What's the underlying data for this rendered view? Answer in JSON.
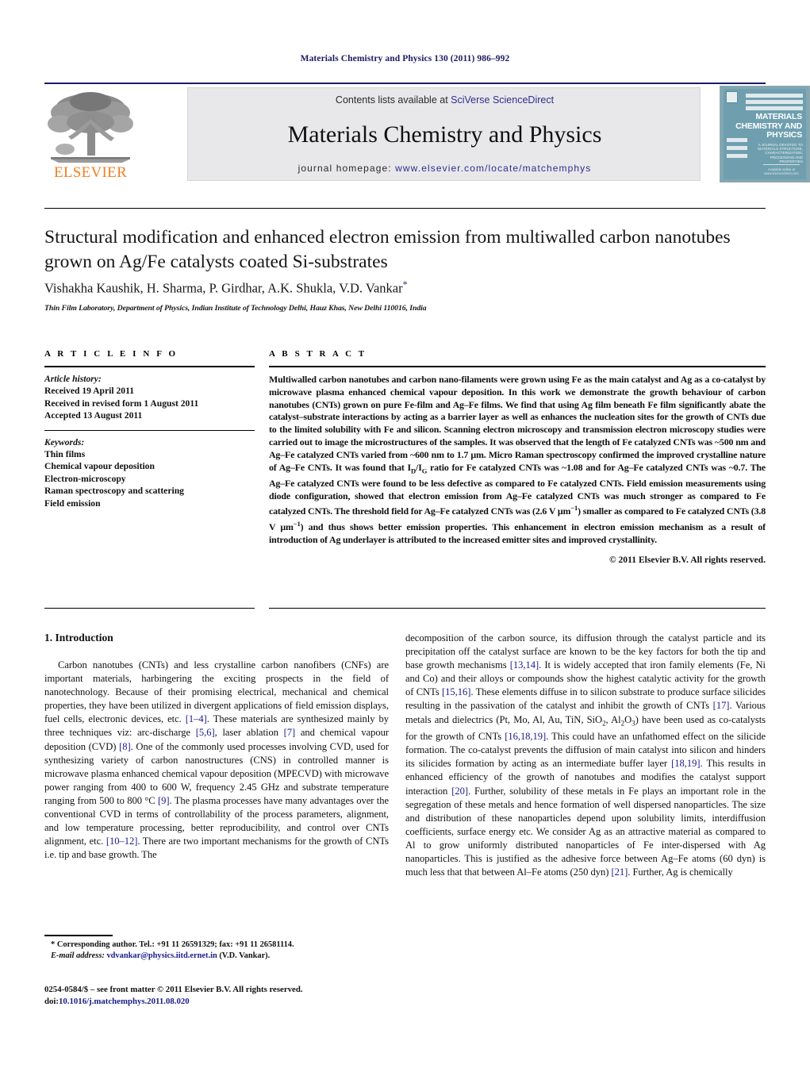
{
  "running_head": "Materials Chemistry and Physics 130 (2011) 986–992",
  "masthead": {
    "contents_prefix": "Contents lists available at ",
    "contents_link": "SciVerse ScienceDirect",
    "journal_title": "Materials Chemistry and Physics",
    "homepage_prefix": "journal homepage: ",
    "homepage_url": "www.elsevier.com/locate/matchemphys",
    "publisher_wordmark": "ELSEVIER",
    "cover": {
      "title_lines": [
        "MATERIALS",
        "CHEMISTRY AND",
        "PHYSICS"
      ],
      "subtitle": "A JOURNAL DEVOTED TO MATERIALS STRUCTURE, CHARACTERIZATION, PROCESSING AND PROPERTIES",
      "footer": "Available online at www.sciencedirect.com"
    },
    "colors": {
      "link": "#2d2d8f",
      "band": "#e8e8ea",
      "elsevier_orange": "#f08023",
      "cover_teal": "#6f9faf",
      "running_head": "#1b1b63"
    }
  },
  "article": {
    "title": "Structural modification and enhanced electron emission from multiwalled carbon nanotubes grown on Ag/Fe catalysts coated Si-substrates",
    "authors": "Vishakha Kaushik, H. Sharma, P. Girdhar, A.K. Shukla, V.D. Vankar",
    "author_marker": "*",
    "affiliation": "Thin Film Laboratory, Department of Physics, Indian Institute of Technology Delhi, Hauz Khas, New Delhi 110016, India"
  },
  "article_info": {
    "heading": "A R T I C L E  I N F O",
    "history_label": "Article history:",
    "history": [
      "Received 19 April 2011",
      "Received in revised form 1 August 2011",
      "Accepted 13 August 2011"
    ],
    "keywords_label": "Keywords:",
    "keywords": [
      "Thin films",
      "Chemical vapour deposition",
      "Electron-microscopy",
      "Raman spectroscopy and scattering",
      "Field emission"
    ]
  },
  "abstract": {
    "heading": "A B S T R A C T",
    "text": "Multiwalled carbon nanotubes and carbon nano-filaments were grown using Fe as the main catalyst and Ag as a co-catalyst by microwave plasma enhanced chemical vapour deposition. In this work we demonstrate the growth behaviour of carbon nanotubes (CNTs) grown on pure Fe-film and Ag–Fe films. We find that using Ag film beneath Fe film significantly abate the catalyst–substrate interactions by acting as a barrier layer as well as enhances the nucleation sites for the growth of CNTs due to the limited solubility with Fe and silicon. Scanning electron microscopy and transmission electron microscopy studies were carried out to image the microstructures of the samples. It was observed that the length of Fe catalyzed CNTs was ~500 nm and Ag–Fe catalyzed CNTs varied from ~600 nm to 1.7 μm. Micro Raman spectroscopy confirmed the improved crystalline nature of Ag–Fe CNTs. It was found that ID/IG ratio for Fe catalyzed CNTs was ~1.08 and for Ag–Fe catalyzed CNTs was ~0.7. The Ag–Fe catalyzed CNTs were found to be less defective as compared to Fe catalyzed CNTs. Field emission measurements using diode configuration, showed that electron emission from Ag–Fe catalyzed CNTs was much stronger as compared to Fe catalyzed CNTs. The threshold field for Ag–Fe catalyzed CNTs was (2.6 V μm−1) smaller as compared to Fe catalyzed CNTs (3.8 V μm−1) and thus shows better emission properties. This enhancement in electron emission mechanism as a result of introduction of Ag underlayer is attributed to the increased emitter sites and improved crystallinity.",
    "copyright": "© 2011 Elsevier B.V. All rights reserved."
  },
  "body": {
    "section_heading": "1.  Introduction",
    "left_paragraph": "Carbon nanotubes (CNTs) and less crystalline carbon nanofibers (CNFs) are important materials, harbingering the exciting prospects in the field of nanotechnology. Because of their promising electrical, mechanical and chemical properties, they have been utilized in divergent applications of field emission displays, fuel cells, electronic devices, etc. [1–4]. These materials are synthesized mainly by three techniques viz: arc-discharge [5,6], laser ablation [7] and chemical vapour deposition (CVD) [8]. One of the commonly used processes involving CVD, used for synthesizing variety of carbon nanostructures (CNS) in controlled manner is microwave plasma enhanced chemical vapour deposition (MPECVD) with microwave power ranging from 400 to 600 W, frequency 2.45 GHz and substrate temperature ranging from 500 to 800 °C [9]. The plasma processes have many advantages over the conventional CVD in terms of controllability of the process parameters, alignment, and low temperature processing, better reproducibility, and control over CNTs alignment, etc. [10–12]. There are two important mechanisms for the growth of CNTs i.e. tip and base growth. The",
    "right_paragraph": "decomposition of the carbon source, its diffusion through the catalyst particle and its precipitation off the catalyst surface are known to be the key factors for both the tip and base growth mechanisms [13,14]. It is widely accepted that iron family elements (Fe, Ni and Co) and their alloys or compounds show the highest catalytic activity for the growth of CNTs [15,16]. These elements diffuse in to silicon substrate to produce surface silicides resulting in the passivation of the catalyst and inhibit the growth of CNTs [17]. Various metals and dielectrics (Pt, Mo, Al, Au, TiN, SiO2, Al2O3) have been used as co-catalysts for the growth of CNTs [16,18,19]. This could have an unfathomed effect on the silicide formation. The co-catalyst prevents the diffusion of main catalyst into silicon and hinders its silicides formation by acting as an intermediate buffer layer [18,19]. This results in enhanced efficiency of the growth of nanotubes and modifies the catalyst support interaction [20]. Further, solubility of these metals in Fe plays an important role in the segregation of these metals and hence formation of well dispersed nanoparticles. The size and distribution of these nanoparticles depend upon solubility limits, interdiffusion coefficients, surface energy etc. We consider Ag as an attractive material as compared to Al to grow uniformly distributed nanoparticles of Fe inter-dispersed with Ag nanoparticles. This is justified as the adhesive force between Ag–Fe atoms (60 dyn) is much less that that between Al–Fe atoms (250 dyn) [21]. Further, Ag is chemically"
  },
  "footer": {
    "corresponding_marker": "*",
    "corresponding_text": "Corresponding author. Tel.: +91 11 26591329; fax: +91 11 26581114.",
    "email_label": "E-mail address:",
    "email": "vdvankar@physics.iitd.ernet.in",
    "email_owner": "(V.D. Vankar).",
    "imprint_line": "0254-0584/$ – see front matter © 2011 Elsevier B.V. All rights reserved.",
    "doi_label": "doi:",
    "doi": "10.1016/j.matchemphys.2011.08.020"
  }
}
